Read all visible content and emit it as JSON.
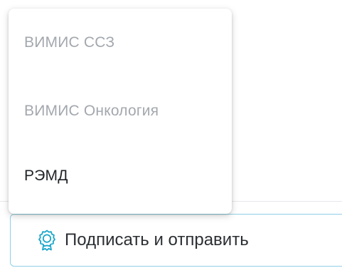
{
  "dropdown": {
    "items": [
      {
        "label": "ВИМИС ССЗ",
        "state": "disabled"
      },
      {
        "label": "ВИМИС Онкология",
        "state": "disabled"
      },
      {
        "label": "РЭМД",
        "state": "enabled"
      }
    ]
  },
  "sign_button": {
    "label": "Подписать и отправить",
    "icon": "certificate-badge-icon",
    "icon_color": "#1aa6c9"
  },
  "colors": {
    "disabled_text": "#a3a8ae",
    "enabled_text": "#1f2226",
    "button_border": "#8fd0e6"
  }
}
